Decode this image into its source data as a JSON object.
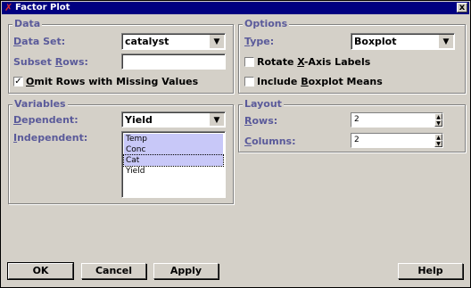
{
  "window": {
    "title": "Factor Plot",
    "close_glyph": "x"
  },
  "data_group": {
    "title": "Data",
    "data_set_label": "Data Set:",
    "data_set_value": "catalyst",
    "subset_rows_label": "Subset Rows:",
    "subset_rows_value": "",
    "omit_label": "Omit Rows with Missing Values",
    "omit_checked": true
  },
  "options_group": {
    "title": "Options",
    "type_label": "Type:",
    "type_value": "Boxplot",
    "rotate_label": "Rotate X-Axis Labels",
    "rotate_checked": false,
    "means_label": "Include Boxplot Means",
    "means_checked": false
  },
  "variables_group": {
    "title": "Variables",
    "dependent_label": "Dependent:",
    "dependent_value": "Yield",
    "independent_label": "Independent:",
    "independent_items": [
      {
        "label": "Temp",
        "selected": true
      },
      {
        "label": "Conc",
        "selected": true
      },
      {
        "label": "Cat",
        "selected": true
      },
      {
        "label": "Yield",
        "selected": false
      }
    ]
  },
  "layout_group": {
    "title": "Layout",
    "rows_label": "Rows:",
    "rows_value": "2",
    "columns_label": "Columns:",
    "columns_value": "2"
  },
  "buttons": {
    "ok": "OK",
    "cancel": "Cancel",
    "apply": "Apply",
    "help": "Help"
  },
  "colors": {
    "title_bar": "#000080",
    "label": "#5a5a9a",
    "selection": "#c8c8f8",
    "face": "#d4d0c8"
  }
}
